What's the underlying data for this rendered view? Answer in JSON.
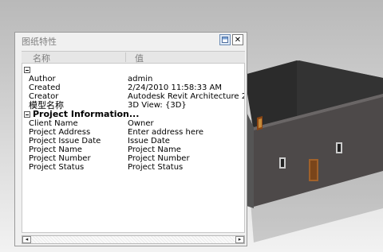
{
  "panel": {
    "title": "图纸特性",
    "columns": {
      "name": "名称",
      "value": "值"
    },
    "rows": [
      {
        "type": "group",
        "label": ""
      },
      {
        "type": "prop",
        "name": "Author",
        "value": "admin"
      },
      {
        "type": "prop",
        "name": "Created",
        "value": "2/24/2010 11:58:33 AM"
      },
      {
        "type": "prop",
        "name": "Creator",
        "value": "Autodesk Revit Architecture 201"
      },
      {
        "type": "prop",
        "name": "模型名称",
        "value": "3D View: {3D}"
      },
      {
        "type": "group",
        "label": "Project Information..."
      },
      {
        "type": "prop",
        "name": "Client Name",
        "value": "Owner"
      },
      {
        "type": "prop",
        "name": "Project Address",
        "value": "Enter address here"
      },
      {
        "type": "prop",
        "name": "Project Issue Date",
        "value": "Issue Date"
      },
      {
        "type": "prop",
        "name": "Project Name",
        "value": "Project Name"
      },
      {
        "type": "prop",
        "name": "Project Number",
        "value": "Project Number"
      },
      {
        "type": "prop",
        "name": "Project Status",
        "value": "Project Status"
      }
    ],
    "buttons": {
      "properties_icon": "properties-icon",
      "close_icon": "close-icon",
      "close_glyph": "✕"
    },
    "scroll": {
      "left_glyph": "◂",
      "right_glyph": "▸"
    }
  }
}
